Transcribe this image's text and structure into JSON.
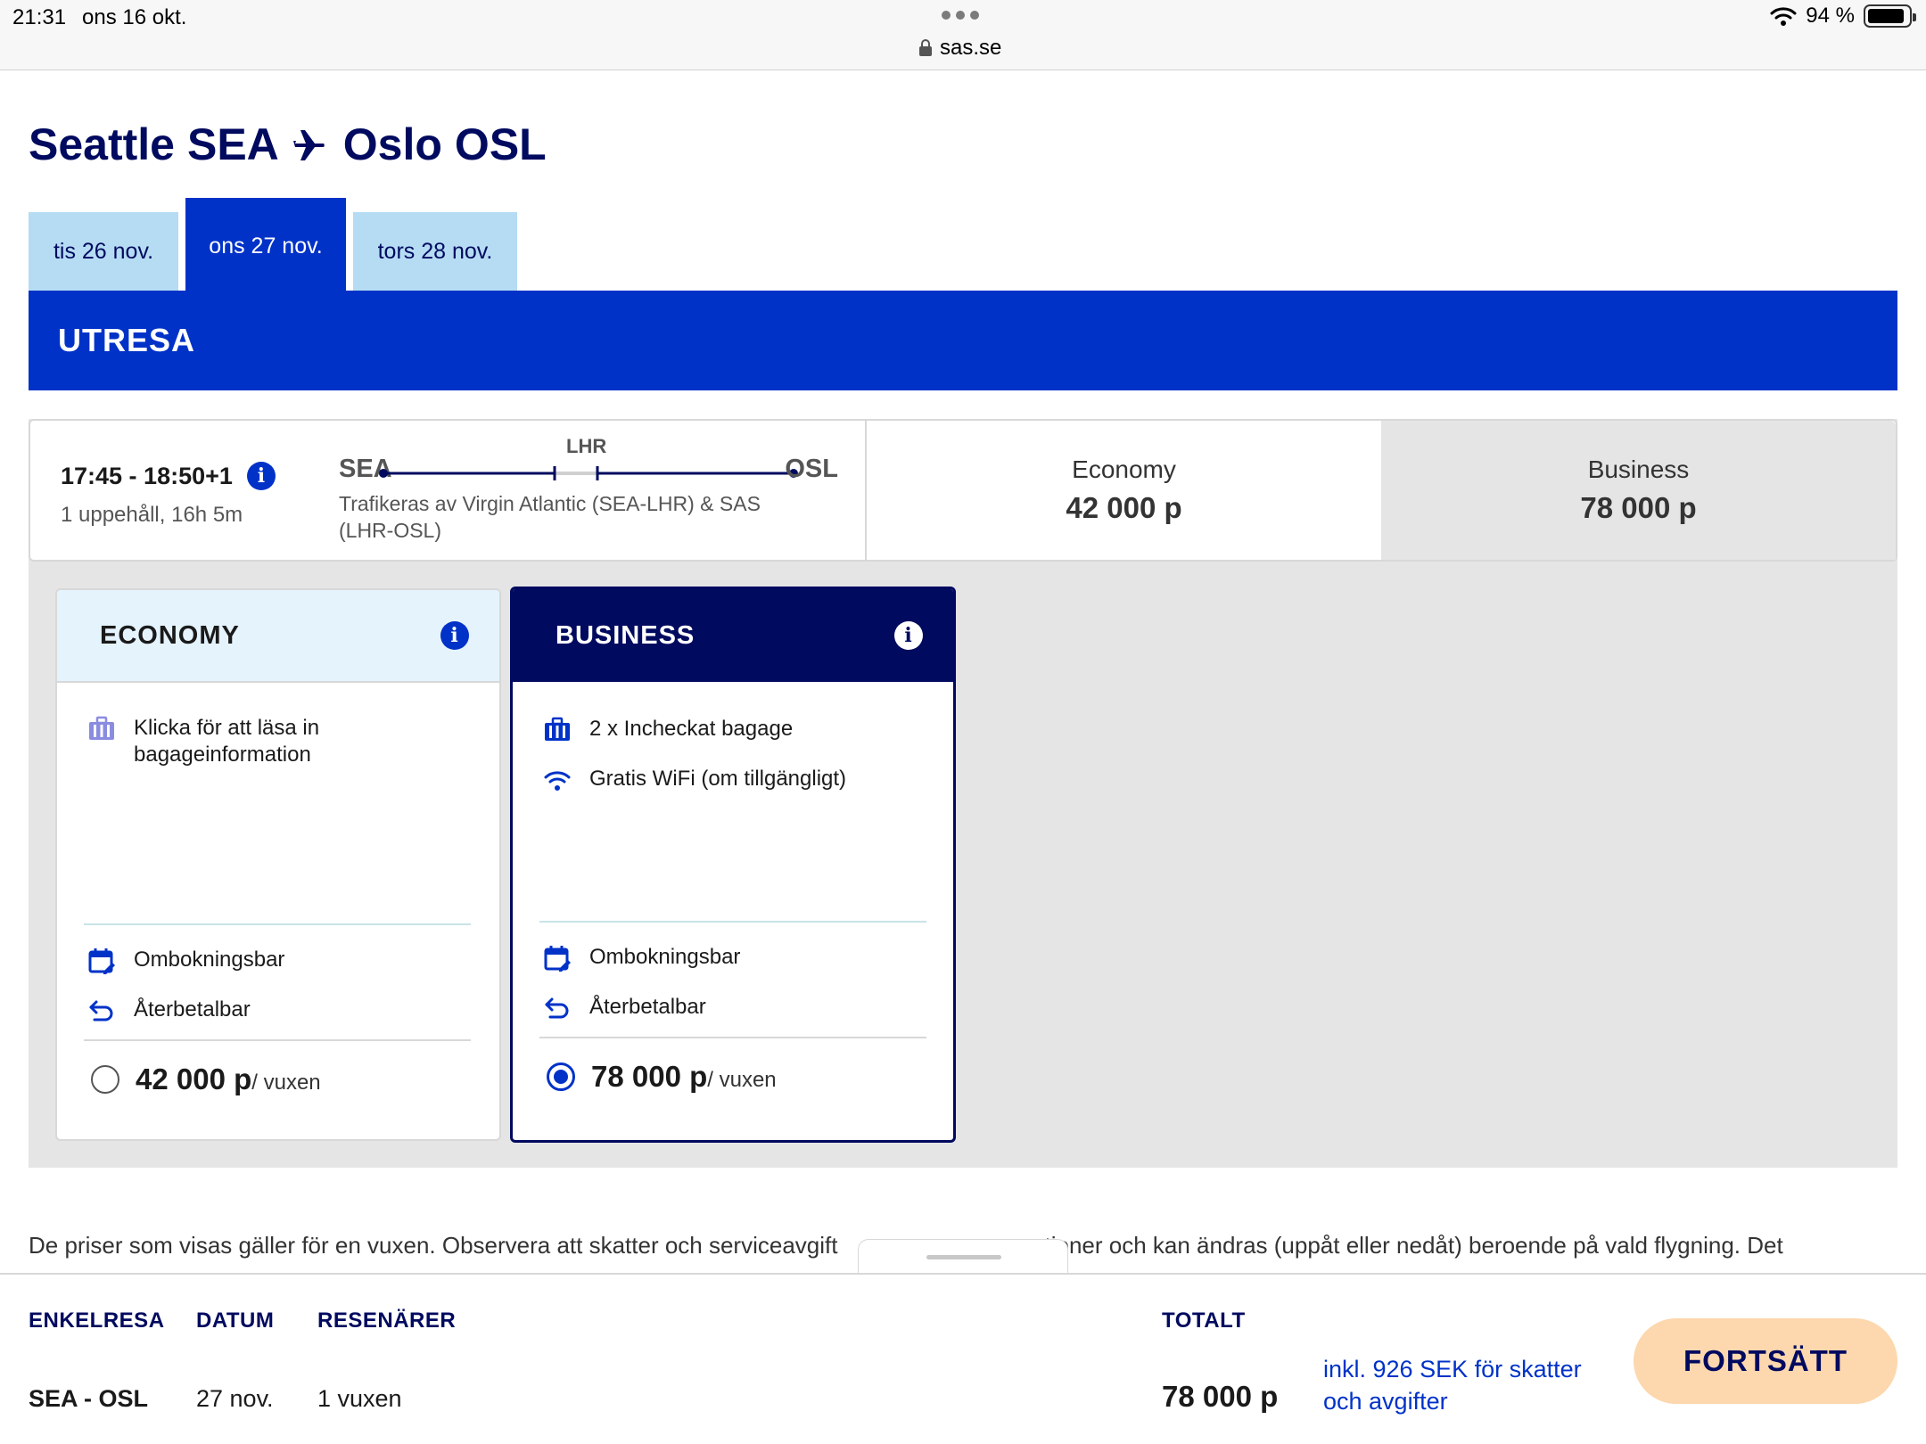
{
  "status_bar": {
    "time": "21:31",
    "date": "ons 16 okt.",
    "url": "sas.se",
    "battery": "94 %"
  },
  "route": {
    "from_city": "Seattle",
    "from_code": "SEA",
    "to_city": "Oslo",
    "to_code": "OSL"
  },
  "date_tabs": [
    {
      "label": "tis 26 nov.",
      "active": false
    },
    {
      "label": "ons 27 nov.",
      "active": true
    },
    {
      "label": "tors 28 nov.",
      "active": false
    }
  ],
  "section_title": "UTRESA",
  "flight": {
    "time": "17:45 - 18:50+1",
    "stops": "1 uppehåll, 16h 5m",
    "origin": "SEA",
    "via": "LHR",
    "destination": "OSL",
    "operated_by": "Trafikeras av Virgin Atlantic (SEA-LHR) & SAS (LHR-OSL)",
    "prices": [
      {
        "label": "Economy",
        "value": "42 000 p",
        "selected": false
      },
      {
        "label": "Business",
        "value": "78 000 p",
        "selected": true
      }
    ]
  },
  "fares": {
    "economy": {
      "title": "ECONOMY",
      "features": [
        "Klicka för att läsa in bagageinformation"
      ],
      "rebook": "Ombokningsbar",
      "refund": "Återbetalbar",
      "price": "42 000 p",
      "per": "/ vuxen",
      "selected": false
    },
    "business": {
      "title": "BUSINESS",
      "features": [
        "2 x Incheckat bagage",
        "Gratis WiFi (om tillgängligt)"
      ],
      "rebook": "Ombokningsbar",
      "refund": "Återbetalbar",
      "price": "78 000 p",
      "per": "/ vuxen",
      "selected": true
    }
  },
  "disclaimer": "De priser som visas gäller för en vuxen. Observera att skatter och serviceavgift",
  "disclaimer_rest": "tioner och kan ändras (uppåt eller nedåt) beroende på vald flygning. Det",
  "summary": {
    "trip_label": "ENKELRESA",
    "trip_value": "SEA - OSL",
    "date_label": "DATUM",
    "date_value": "27 nov.",
    "travellers_label": "RESENÄRER",
    "travellers_value": "1 vuxen",
    "total_label": "TOTALT",
    "total_value": "78 000 p",
    "tax_note": "inkl. 926 SEK för skatter och avgifter",
    "continue_label": "FORTSÄTT"
  },
  "colors": {
    "primary": "#0032c8",
    "navy": "#000a5f",
    "tab": "#b5dcf3",
    "cta": "#fdd7ad"
  }
}
